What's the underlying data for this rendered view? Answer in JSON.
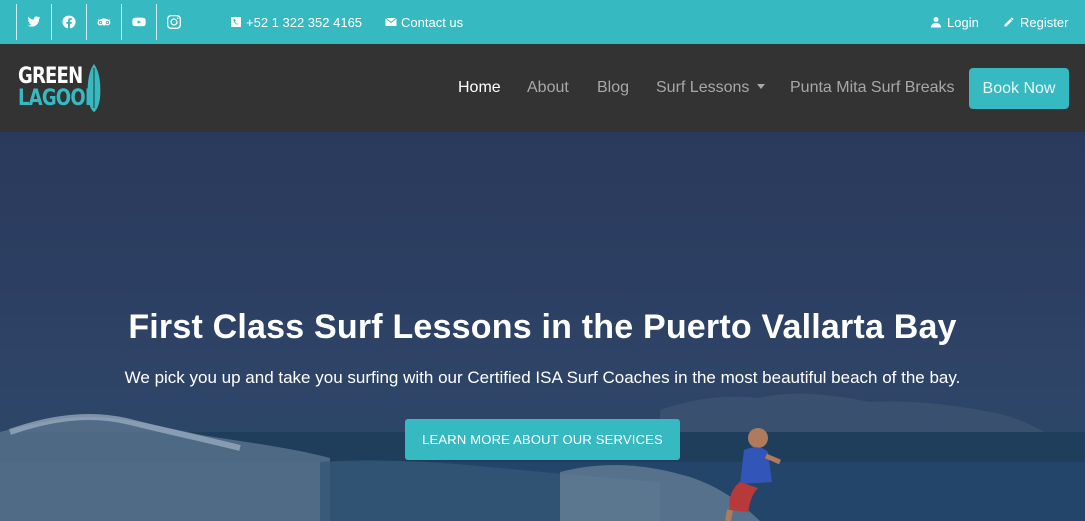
{
  "topbar": {
    "social": [
      {
        "icon": "twitter-icon"
      },
      {
        "icon": "facebook-icon"
      },
      {
        "icon": "tripadvisor-icon"
      },
      {
        "icon": "youtube-icon"
      },
      {
        "icon": "instagram-icon"
      }
    ],
    "phone": "+52 1 322 352 4165",
    "contact": "Contact us",
    "login": "Login",
    "register": "Register"
  },
  "brand": {
    "line1": "GREEN",
    "line2": "LAGOON"
  },
  "nav": {
    "items": [
      {
        "label": "Home",
        "active": true
      },
      {
        "label": "About"
      },
      {
        "label": "Blog"
      },
      {
        "label": "Surf Lessons",
        "dropdown": true
      },
      {
        "label": "Punta Mita Surf Breaks"
      }
    ],
    "book": "Book Now"
  },
  "hero": {
    "title": "First Class Surf Lessons in the Puerto Vallarta Bay",
    "subtitle": "We pick you up and take you surfing with our Certified ISA Surf Coaches in the most beautiful beach of the bay.",
    "cta": "LEARN MORE ABOUT OUR SERVICES"
  },
  "colors": {
    "accent": "#37b9c2",
    "navbar": "#333333",
    "nav_text": "#a8a8a8"
  }
}
